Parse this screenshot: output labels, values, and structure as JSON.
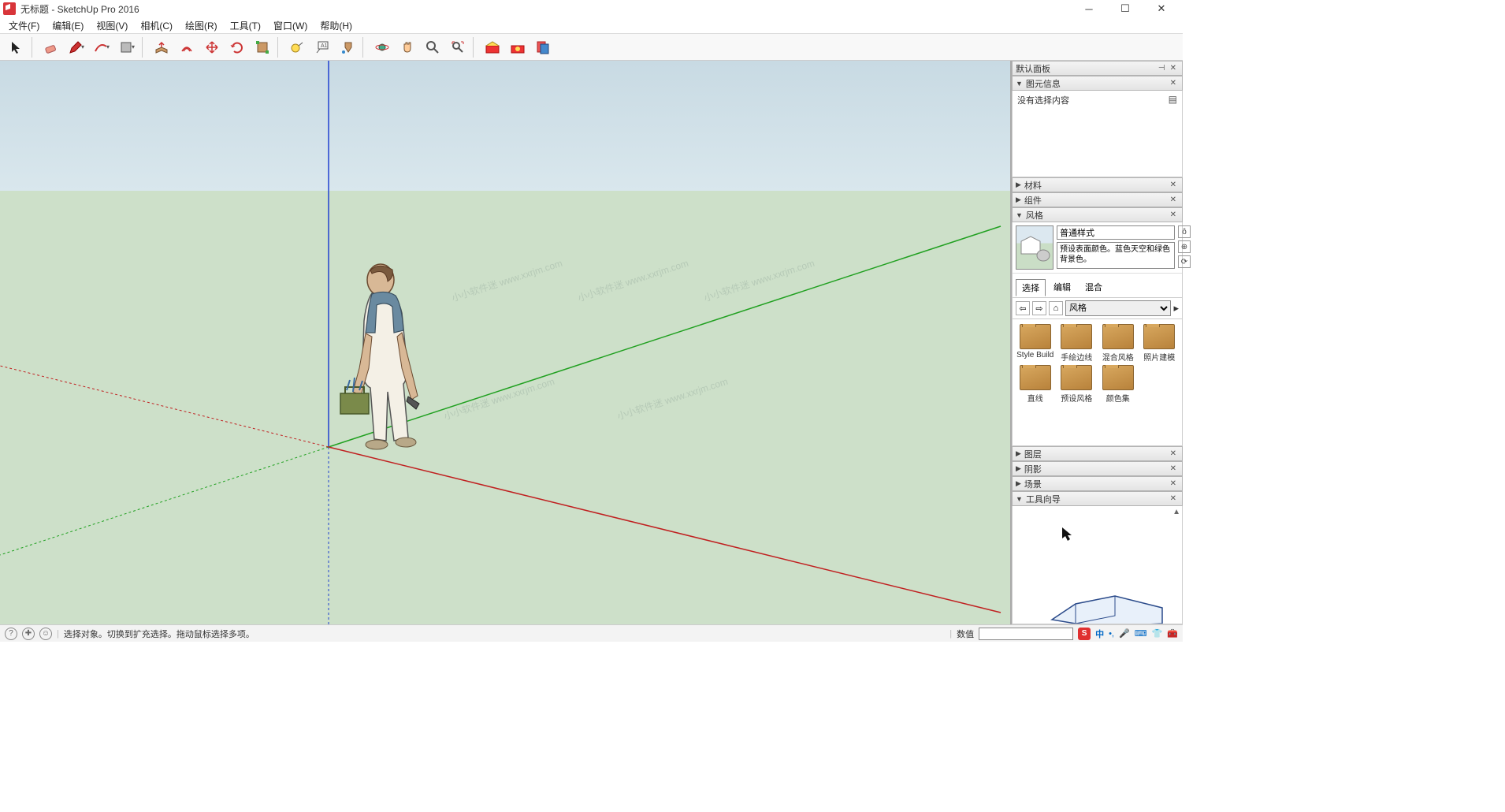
{
  "titlebar": {
    "title": "无标题 - SketchUp Pro 2016"
  },
  "menu": {
    "items": [
      "文件(F)",
      "编辑(E)",
      "视图(V)",
      "相机(C)",
      "绘图(R)",
      "工具(T)",
      "窗口(W)",
      "帮助(H)"
    ]
  },
  "toolbar_icons": [
    "select",
    "eraser",
    "pencil",
    "arc",
    "rectangle",
    "pushpull",
    "offset",
    "move",
    "rotate",
    "scale",
    "tape",
    "text",
    "paint",
    "orbit",
    "pan",
    "zoom",
    "zoom-extents",
    "warehouse",
    "extensions",
    "layout"
  ],
  "side": {
    "default_panel": "默认面板",
    "entity": {
      "header": "图元信息",
      "text": "没有选择内容"
    },
    "materials": {
      "header": "材料"
    },
    "components": {
      "header": "组件"
    },
    "styles": {
      "header": "风格",
      "name": "普通样式",
      "desc": "预设表面颜色。蓝色天空和绿色背景色。",
      "tabs": [
        "选择",
        "编辑",
        "混合"
      ],
      "dropdown": "风格",
      "folders": [
        "Style Build",
        "手绘边线",
        "混合风格",
        "照片建模",
        "直线",
        "预设风格",
        "颜色集"
      ]
    },
    "layers": {
      "header": "图层"
    },
    "shadows": {
      "header": "阴影"
    },
    "scenes": {
      "header": "场景"
    },
    "instructor": {
      "header": "工具向导"
    }
  },
  "statusbar": {
    "hint": "选择对象。切换到扩充选择。拖动鼠标选择多项。",
    "value_label": "数值"
  },
  "ime": {
    "items": [
      "S",
      "中",
      "・",
      "❤",
      "■",
      "◉",
      "⊞",
      "T",
      "▪"
    ]
  }
}
